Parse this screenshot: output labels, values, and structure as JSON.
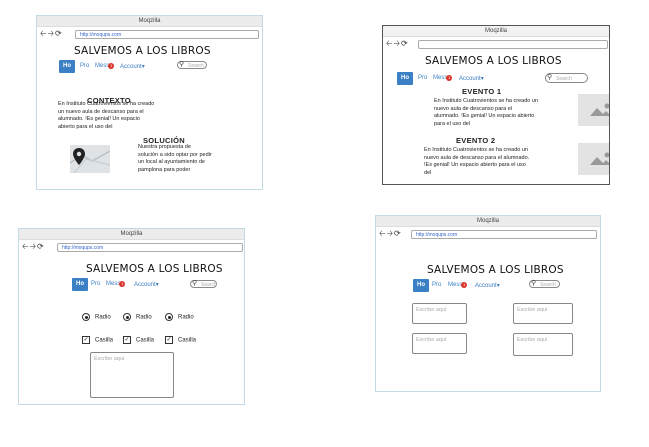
{
  "browser": {
    "title": "Moqzilla",
    "url": "http://moqups.com",
    "back_icon": "arrow-left-icon",
    "forward_icon": "arrow-right-icon",
    "reload_icon": "reload-icon"
  },
  "site": {
    "brand": "SALVEMOS A LOS LIBROS",
    "nav_home": "Ho",
    "nav_pro": "Pro",
    "nav_mess": "Mess",
    "nav_badge": "1",
    "nav_account": "Account",
    "search_placeholder": "Search"
  },
  "frame1": {
    "contexto_title": "CONTEXTO",
    "contexto_text": "En Instituto Cuatrovientos se ha creado un nuevo aula de descanso para el alumnado. !Es genial! Un espacio abierto para el uso del",
    "solucion_title": "SOLUCIÓN",
    "solucion_text": "Nuestra propuesta de solución a sido optar por pedir un local al ayuntamiento de pamplona para poder"
  },
  "frame2": {
    "evento1_title": "EVENTO 1",
    "evento1_text": "En Instituto Cuatrovientos se ha creado un nuevo aula de descanso para el alumnado. !Es genial! Un espacio abierto para el uso del",
    "evento2_title": "EVENTO 2",
    "evento2_text": "En Instituto Cuatrovientos se ha creado un nuevo aula de descanso para el alumnado. !Es genial! Un espacio abierto para el uso del"
  },
  "frame3": {
    "radios": [
      "Radio",
      "Radio",
      "Radio"
    ],
    "checks": [
      "Casilla",
      "Casilla",
      "Casilla"
    ],
    "textarea_placeholder": "Escribe aquí"
  },
  "frame4": {
    "field1": "Escribe aquí",
    "field2": "Escribe aquí",
    "field3": "Escribe aquí",
    "field4": "Escribe aquí"
  }
}
